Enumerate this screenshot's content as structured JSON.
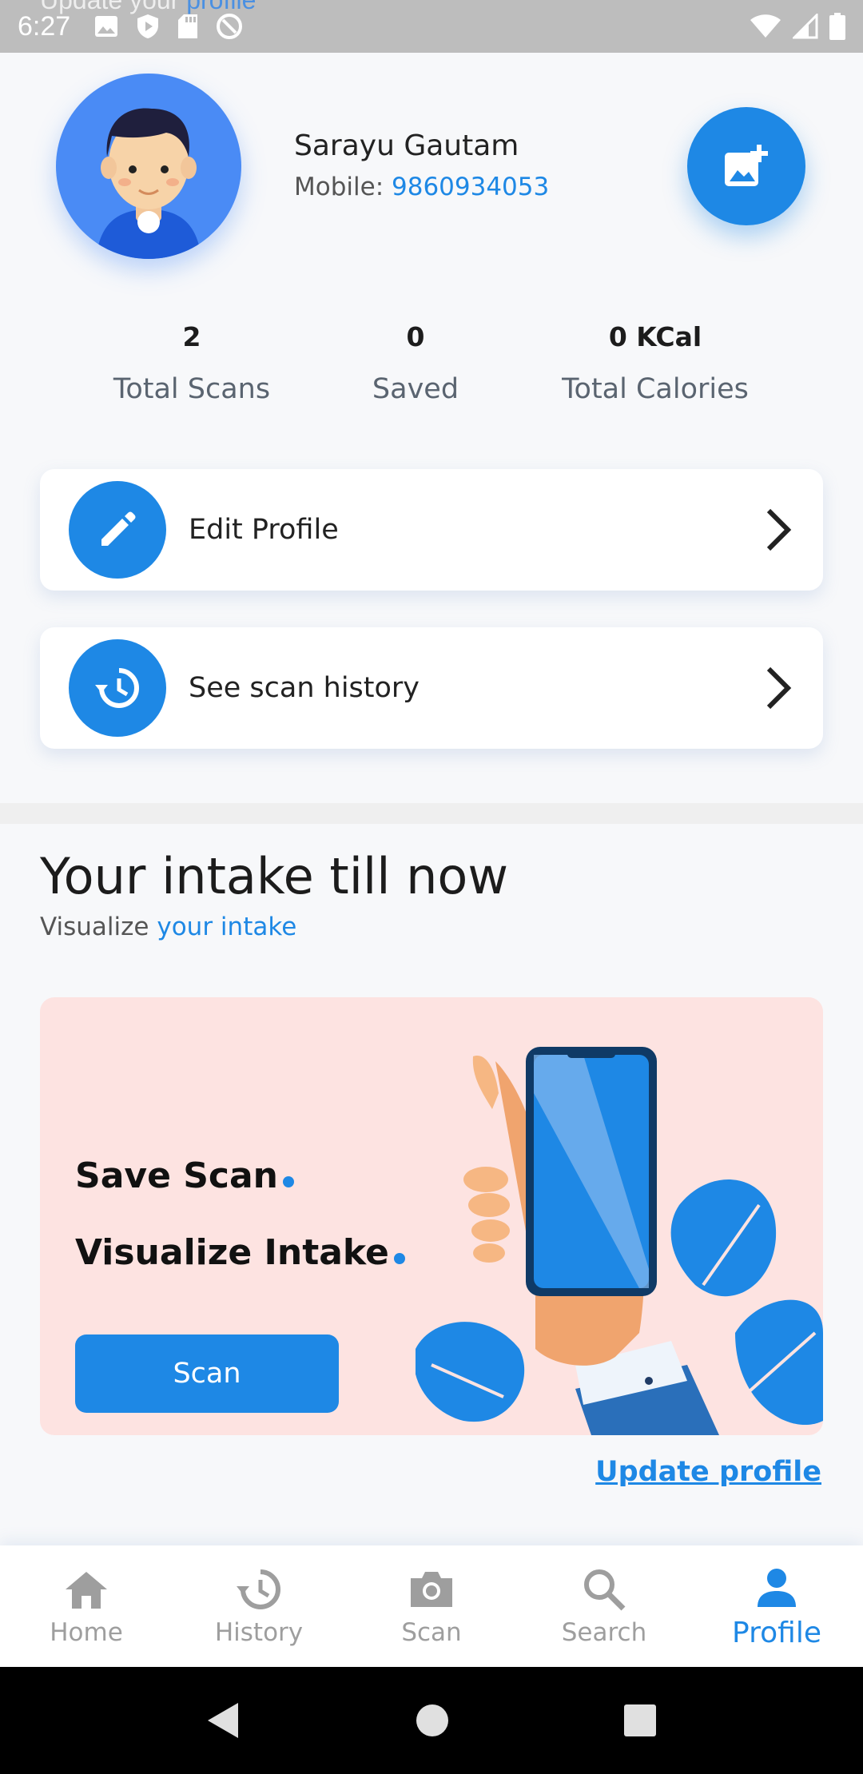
{
  "status_bar": {
    "time": "6:27",
    "peek_text_a": "Update your",
    "peek_text_b": "profile",
    "icons": [
      "image-icon",
      "shield-play-icon",
      "sd-card-icon",
      "sync-blocked-icon",
      "wifi-icon",
      "signal-icon",
      "battery-icon"
    ]
  },
  "profile": {
    "name": "Sarayu Gautam",
    "mobile_label": "Mobile:",
    "mobile_number": "9860934053"
  },
  "stats": [
    {
      "value": "2",
      "label": "Total Scans"
    },
    {
      "value": "0",
      "label": "Saved"
    },
    {
      "value": "0 KCal",
      "label": "Total Calories"
    }
  ],
  "menu": {
    "edit_profile": "Edit Profile",
    "scan_history": "See scan history"
  },
  "intake": {
    "title": "Your intake till now",
    "subtitle_a": "Visualize",
    "subtitle_b": "your intake"
  },
  "promo": {
    "line1": "Save Scan",
    "line2": "Visualize Intake",
    "button": "Scan"
  },
  "update_link": "Update profile",
  "bottom_nav": [
    {
      "label": "Home",
      "icon": "home-icon",
      "active": false
    },
    {
      "label": "History",
      "icon": "history-icon",
      "active": false
    },
    {
      "label": "Scan",
      "icon": "camera-icon",
      "active": false
    },
    {
      "label": "Search",
      "icon": "search-icon",
      "active": false
    },
    {
      "label": "Profile",
      "icon": "person-icon",
      "active": true
    }
  ],
  "colors": {
    "accent": "#1e88e5",
    "promo_bg": "#fde3e1",
    "inactive": "#9e9e9e"
  }
}
